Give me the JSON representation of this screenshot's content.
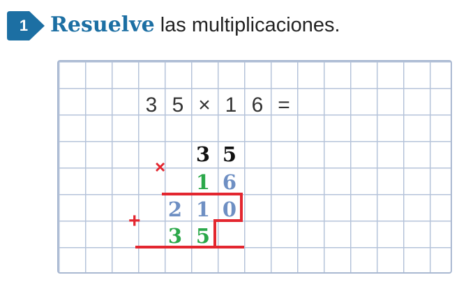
{
  "header": {
    "badge_number": "1",
    "verb": "Resuelve",
    "instruction": "las multiplicaciones."
  },
  "exercise": {
    "equation": [
      "3",
      "5",
      "×",
      "1",
      "6",
      "="
    ],
    "multiplicand": [
      "3",
      "5"
    ],
    "multiplier": [
      "1",
      "6"
    ],
    "multiply_sign": "×",
    "add_sign": "+",
    "partial_product_1": [
      "2",
      "1",
      "0"
    ],
    "partial_product_2": [
      "3",
      "5"
    ]
  },
  "colors": {
    "brand": "#1c6fa3",
    "grid_line": "#b5c3da",
    "operation_red": "#e3262f",
    "digit_green": "#2ba84a",
    "digit_blue": "#6e8fc3"
  }
}
